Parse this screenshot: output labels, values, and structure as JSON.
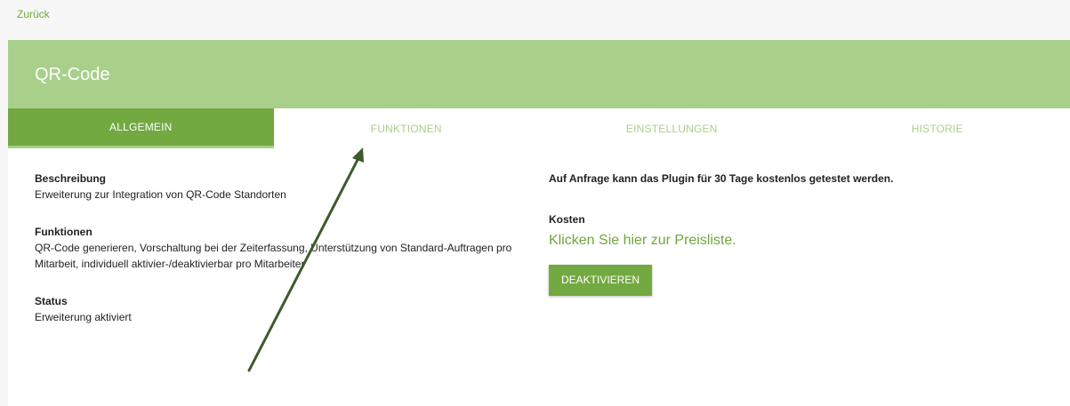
{
  "nav": {
    "back_label": "Zurück"
  },
  "header": {
    "title": "QR-Code"
  },
  "tabs": [
    {
      "label": "ALLGEMEIN",
      "active": true
    },
    {
      "label": "FUNKTIONEN",
      "active": false
    },
    {
      "label": "EINSTELLUNGEN",
      "active": false
    },
    {
      "label": "HISTORIE",
      "active": false
    }
  ],
  "details": {
    "description_heading": "Beschreibung",
    "description_text": "Erweiterung zur Integration von QR-Code Standorten",
    "functions_heading": "Funktionen",
    "functions_text": "QR-Code generieren, Vorschaltung bei der Zeiterfassung, Unterstützung von Standard-Auftragen pro Mitarbeit, individuell aktivier-/deaktivierbar pro Mitarbeiter",
    "status_heading": "Status",
    "status_text": "Erweiterung aktiviert"
  },
  "side": {
    "trial_note": "Auf Anfrage kann das Plugin für 30 Tage kostenlos getestet werden.",
    "costs_heading": "Kosten",
    "price_link": "Klicken Sie hier zur Preisliste.",
    "deactivate_label": "DEAKTIVIEREN"
  },
  "colors": {
    "accent": "#72a941",
    "header_bg": "#a9d08a",
    "link": "#6ea83c",
    "annotation_arrow": "#3d5a2a"
  }
}
